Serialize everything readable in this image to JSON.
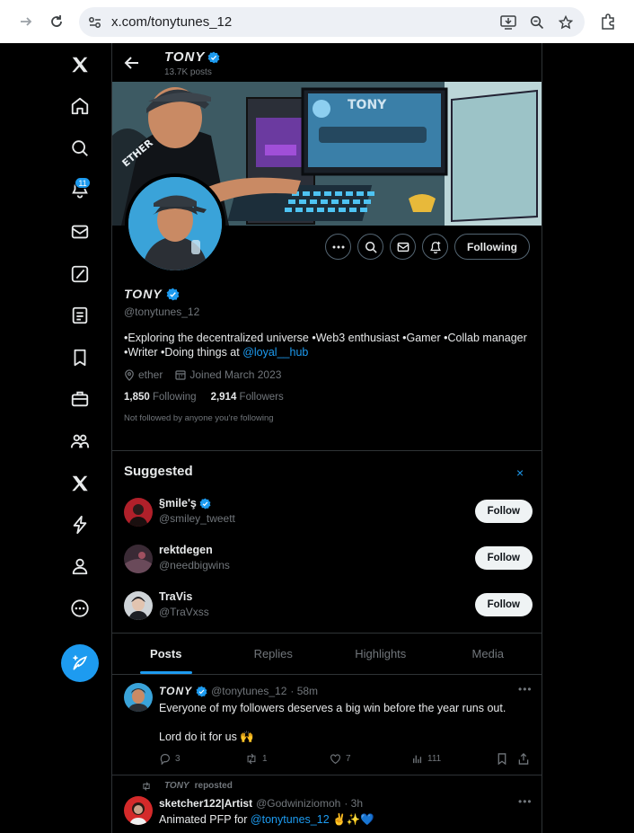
{
  "browser": {
    "url": "x.com/tonytunes_12"
  },
  "nav": {
    "notification_count": "11"
  },
  "profile": {
    "display_name": "TONY",
    "post_count": "13.7K posts",
    "handle": "@tonytunes_12",
    "bio_text": "•Exploring the decentralized universe •Web3 enthusiast •Gamer •Collab manager •Writer •Doing things at ",
    "bio_link": "@loyal__hub",
    "location": "ether",
    "joined": "Joined March 2023",
    "following_count": "1,850",
    "following_label": "Following",
    "followers_count": "2,914",
    "followers_label": "Followers",
    "not_followed_note": "Not followed by anyone you're following",
    "following_button": "Following"
  },
  "suggested": {
    "title": "Suggested",
    "close": "×",
    "users": [
      {
        "name": "§mile'ş",
        "handle": "@smiley_tweett",
        "verified": true,
        "button": "Follow"
      },
      {
        "name": "rektdegen",
        "handle": "@needbigwins",
        "verified": false,
        "button": "Follow"
      },
      {
        "name": "TraVis",
        "handle": "@TraVxss",
        "verified": false,
        "button": "Follow"
      }
    ]
  },
  "tabs": [
    {
      "label": "Posts",
      "active": true
    },
    {
      "label": "Replies",
      "active": false
    },
    {
      "label": "Highlights",
      "active": false
    },
    {
      "label": "Media",
      "active": false
    }
  ],
  "tweets": [
    {
      "name": "TONY",
      "handle": "@tonytunes_12",
      "time": "· 58m",
      "line1": "Everyone of my followers deserves a big win before the year runs out.",
      "line2": "Lord do it for us 🙌",
      "replies": "3",
      "reposts": "1",
      "likes": "7",
      "views": "111"
    },
    {
      "repost_by": "TONY",
      "repost_label": "reposted",
      "name": "sketcher122|Artist",
      "handle": "@Godwiniziomoh",
      "time": "· 3h",
      "text": "Animated PFP for ",
      "mention": "@tonytunes_12",
      "emoji": " ✌️✨💙"
    }
  ],
  "colors": {
    "accent": "#1d9bf0",
    "background": "#000000",
    "border": "#2f3336",
    "muted_text": "#71767b"
  }
}
